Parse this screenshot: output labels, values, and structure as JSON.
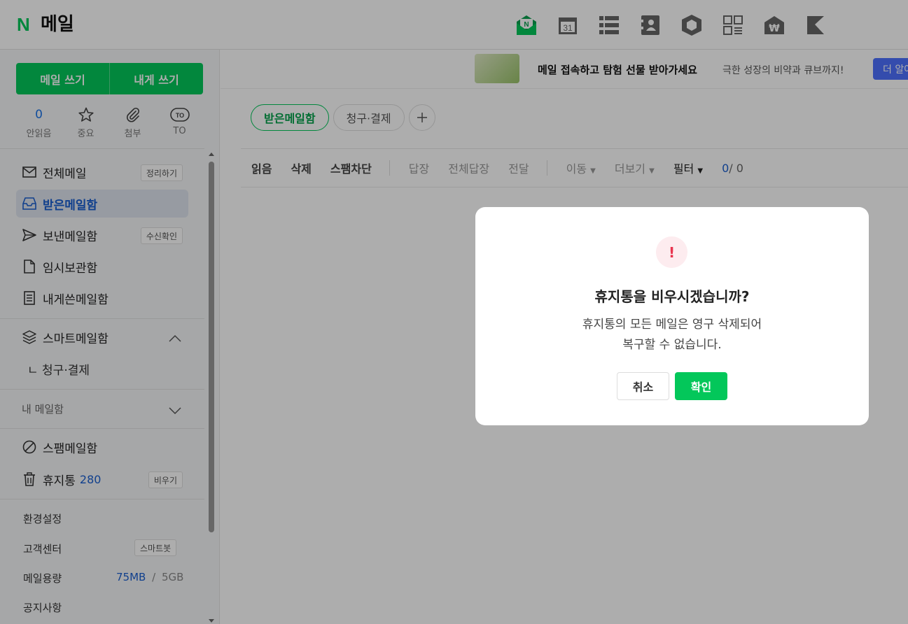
{
  "header": {
    "logo_letter": "N",
    "title": "메일",
    "apps": [
      "mail-app-icon",
      "calendar-app-icon",
      "contacts-list-icon",
      "address-book-icon",
      "box-icon",
      "memo-grid-icon",
      "pay-house-icon",
      "bookmark-icon"
    ],
    "calendar_day": "31"
  },
  "sidebar": {
    "write_mail": "메일 쓰기",
    "write_self": "내게 쓰기",
    "quick": [
      {
        "value": "0",
        "label": "안읽음"
      },
      {
        "icon": "star-icon",
        "label": "중요"
      },
      {
        "icon": "paperclip-icon",
        "label": "첨부"
      },
      {
        "icon_text": "TO",
        "label": "TO"
      }
    ],
    "items": [
      {
        "label": "전체메일",
        "tag": "정리하기"
      },
      {
        "label": "받은메일함"
      },
      {
        "label": "보낸메일함",
        "tag": "수신확인"
      },
      {
        "label": "임시보관함"
      },
      {
        "label": "내게쓴메일함"
      },
      {
        "label": "스마트메일함"
      },
      {
        "label": "ㄴ 청구·결제"
      },
      {
        "label": "내 메일함"
      },
      {
        "label": "스팸메일함"
      },
      {
        "label": "휴지통",
        "count": "280",
        "tag": "비우기"
      }
    ],
    "settings": "환경설정",
    "support": "고객센터",
    "support_tag": "스마트봇",
    "storage_label": "메일용량",
    "storage_used": "75MB",
    "storage_sep": "/",
    "storage_total": "5GB",
    "notice": "공지사항"
  },
  "banner": {
    "title": "메일 접속하고 탐험 선물 받아가세요",
    "subtitle": "극한 성장의 비약과 큐브까지!",
    "button": "더 알아보기"
  },
  "tabs": [
    {
      "label": "받은메일함",
      "active": true
    },
    {
      "label": "청구·결제",
      "active": false
    }
  ],
  "toolbar": {
    "read": "읽음",
    "delete": "삭제",
    "spam": "스팸차단",
    "reply": "답장",
    "reply_all": "전체답장",
    "forward": "전달",
    "move": "이동",
    "more": "더보기",
    "filter": "필터",
    "count_current": "0",
    "count_total": "/ 0"
  },
  "dialog": {
    "icon": "!",
    "title": "휴지통을 비우시겠습니까?",
    "line1": "휴지통의 모든 메일은 영구 삭제되어",
    "line2": "복구할 수 없습니다.",
    "cancel": "취소",
    "confirm": "확인"
  },
  "colors": {
    "brand": "#03c75a",
    "accent_blue": "#1a5fd0",
    "alert": "#e8344e",
    "banner_button": "#4d71ff"
  }
}
